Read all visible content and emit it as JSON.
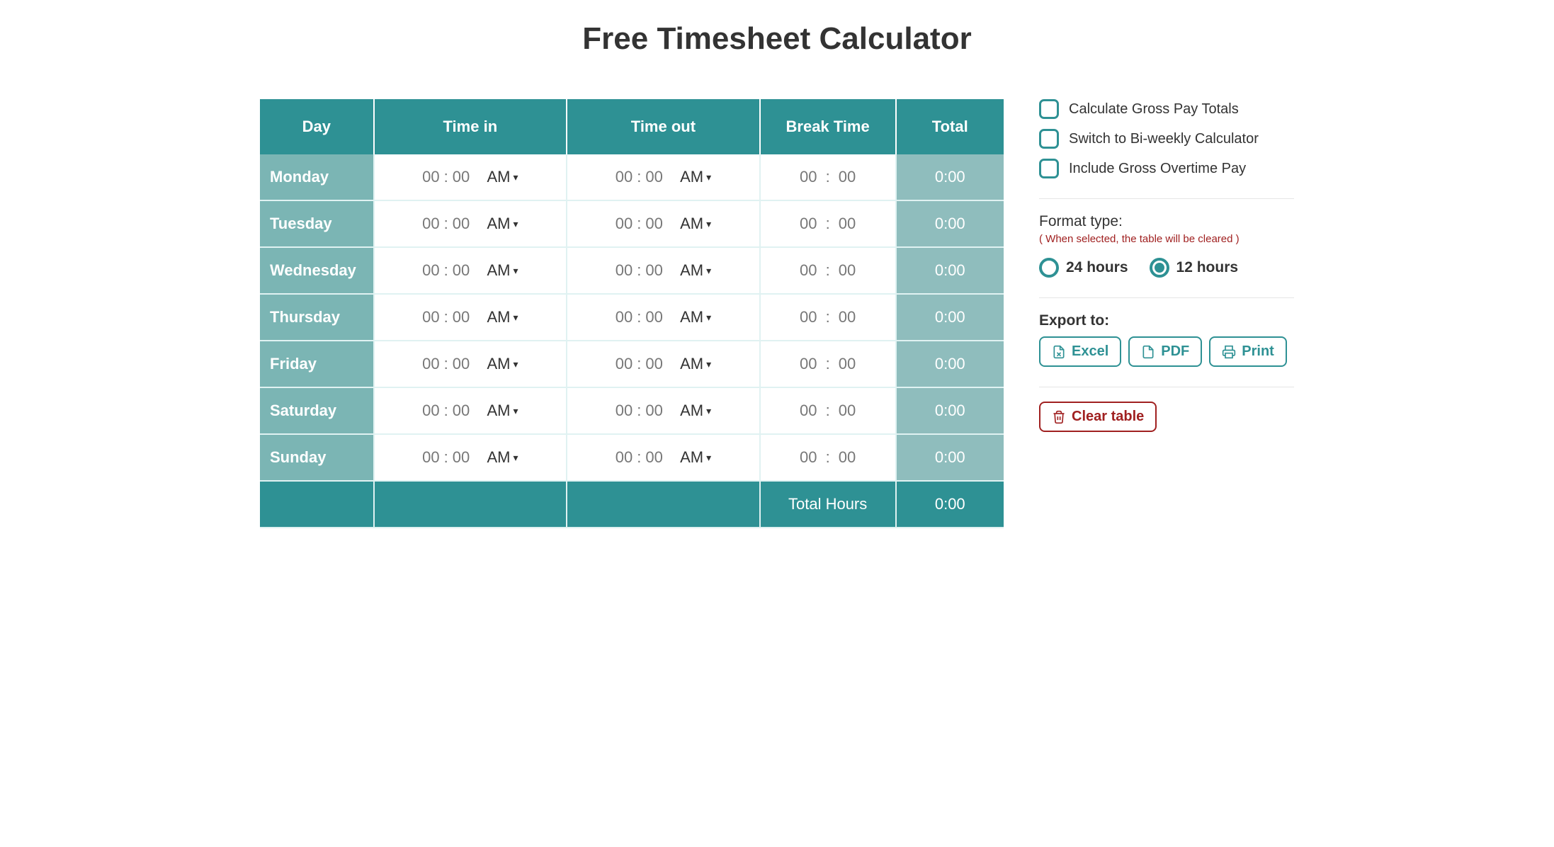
{
  "title": "Free Timesheet Calculator",
  "table": {
    "headers": {
      "day": "Day",
      "time_in": "Time in",
      "time_out": "Time out",
      "break": "Break Time",
      "total": "Total"
    },
    "rows": [
      {
        "day": "Monday",
        "in_h": "00",
        "in_m": "00",
        "in_ampm": "AM",
        "out_h": "00",
        "out_m": "00",
        "out_ampm": "AM",
        "br_h": "00",
        "br_m": "00",
        "total": "0:00"
      },
      {
        "day": "Tuesday",
        "in_h": "00",
        "in_m": "00",
        "in_ampm": "AM",
        "out_h": "00",
        "out_m": "00",
        "out_ampm": "AM",
        "br_h": "00",
        "br_m": "00",
        "total": "0:00"
      },
      {
        "day": "Wednesday",
        "in_h": "00",
        "in_m": "00",
        "in_ampm": "AM",
        "out_h": "00",
        "out_m": "00",
        "out_ampm": "AM",
        "br_h": "00",
        "br_m": "00",
        "total": "0:00"
      },
      {
        "day": "Thursday",
        "in_h": "00",
        "in_m": "00",
        "in_ampm": "AM",
        "out_h": "00",
        "out_m": "00",
        "out_ampm": "AM",
        "br_h": "00",
        "br_m": "00",
        "total": "0:00"
      },
      {
        "day": "Friday",
        "in_h": "00",
        "in_m": "00",
        "in_ampm": "AM",
        "out_h": "00",
        "out_m": "00",
        "out_ampm": "AM",
        "br_h": "00",
        "br_m": "00",
        "total": "0:00"
      },
      {
        "day": "Saturday",
        "in_h": "00",
        "in_m": "00",
        "in_ampm": "AM",
        "out_h": "00",
        "out_m": "00",
        "out_ampm": "AM",
        "br_h": "00",
        "br_m": "00",
        "total": "0:00"
      },
      {
        "day": "Sunday",
        "in_h": "00",
        "in_m": "00",
        "in_ampm": "AM",
        "out_h": "00",
        "out_m": "00",
        "out_ampm": "AM",
        "br_h": "00",
        "br_m": "00",
        "total": "0:00"
      }
    ],
    "footer": {
      "label": "Total Hours",
      "total": "0:00"
    }
  },
  "options": {
    "gross_pay": "Calculate Gross Pay Totals",
    "biweekly": "Switch to Bi-weekly Calculator",
    "overtime": "Include Gross Overtime Pay"
  },
  "format": {
    "label": "Format type:",
    "warn": "( When selected, the table will be cleared )",
    "r24": "24 hours",
    "r12": "12 hours",
    "selected": "12"
  },
  "export": {
    "label": "Export to:",
    "excel": "Excel",
    "pdf": "PDF",
    "print": "Print"
  },
  "clear": "Clear table"
}
